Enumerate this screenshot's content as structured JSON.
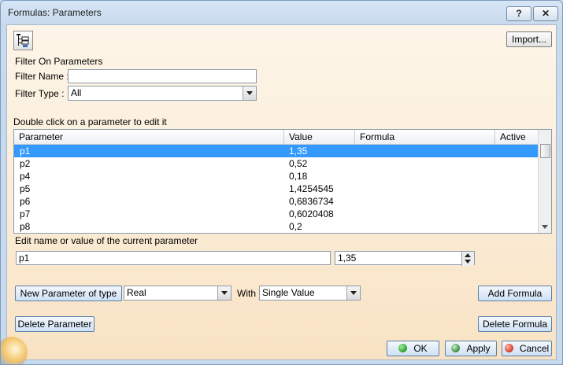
{
  "window": {
    "title": "Formulas: Parameters",
    "help_glyph": "?",
    "close_glyph": "✕"
  },
  "toolbar": {
    "import_label": "Import...",
    "icon": "hierarchy-tree-icon"
  },
  "filter": {
    "section_label": "Filter On Parameters",
    "name_label": "Filter Name :",
    "name_value": "",
    "type_label": "Filter Type :",
    "type_value": "All"
  },
  "table": {
    "hint": "Double click on a parameter to edit it",
    "columns": [
      "Parameter",
      "Value",
      "Formula",
      "Active"
    ],
    "rows": [
      {
        "parameter": "p1",
        "value": "1,35",
        "formula": "",
        "active": ""
      },
      {
        "parameter": "p2",
        "value": "0,52",
        "formula": "",
        "active": ""
      },
      {
        "parameter": "p4",
        "value": "0,18",
        "formula": "",
        "active": ""
      },
      {
        "parameter": "p5",
        "value": "1,4254545",
        "formula": "",
        "active": ""
      },
      {
        "parameter": "p6",
        "value": "0,6836734",
        "formula": "",
        "active": ""
      },
      {
        "parameter": "p7",
        "value": "0,6020408",
        "formula": "",
        "active": ""
      },
      {
        "parameter": "p8",
        "value": "0,2",
        "formula": "",
        "active": ""
      }
    ],
    "selected_index": 0
  },
  "edit": {
    "label": "Edit name or value of the current parameter",
    "name_value": "p1",
    "value_value": "1,35"
  },
  "new_param": {
    "button_label": "New Parameter of type",
    "type_value": "Real",
    "with_label": "With",
    "with_value": "Single Value",
    "add_formula_label": "Add Formula"
  },
  "actions": {
    "delete_parameter_label": "Delete Parameter",
    "delete_formula_label": "Delete Formula",
    "ok_label": "OK",
    "apply_label": "Apply",
    "cancel_label": "Cancel"
  },
  "colors": {
    "selection": "#3399ff",
    "ok": "#2e9a2e",
    "apply": "#3c8a3c",
    "cancel": "#d43a2a"
  }
}
